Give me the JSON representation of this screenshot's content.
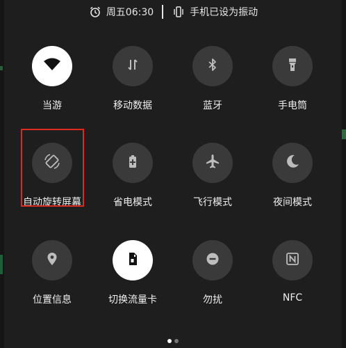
{
  "status_bar": {
    "alarm_icon": "alarm-clock-icon",
    "time": "周五06:30",
    "vibrate_icon": "vibrate-icon",
    "vibrate_text": "手机已设为振动"
  },
  "tiles": [
    {
      "label": "当游",
      "icon": "wifi-icon",
      "active": true
    },
    {
      "label": "移动数据",
      "icon": "mobile-data-icon",
      "active": false
    },
    {
      "label": "蓝牙",
      "icon": "bluetooth-icon",
      "active": false
    },
    {
      "label": "手电筒",
      "icon": "flashlight-icon",
      "active": false
    },
    {
      "label": "自动旋转屏幕",
      "icon": "auto-rotate-icon",
      "active": false
    },
    {
      "label": "省电模式",
      "icon": "battery-saver-icon",
      "active": false
    },
    {
      "label": "飞行模式",
      "icon": "airplane-icon",
      "active": false
    },
    {
      "label": "夜间模式",
      "icon": "moon-icon",
      "active": false
    },
    {
      "label": "位置信息",
      "icon": "location-icon",
      "active": false
    },
    {
      "label": "切换流量卡",
      "icon": "sim-card-icon",
      "active": true
    },
    {
      "label": "勿扰",
      "icon": "do-not-disturb-icon",
      "active": false
    },
    {
      "label": "NFC",
      "icon": "nfc-icon",
      "active": false
    }
  ],
  "highlight_color": "#e0291f",
  "page_indicator": {
    "pages": 2,
    "current": 1
  }
}
